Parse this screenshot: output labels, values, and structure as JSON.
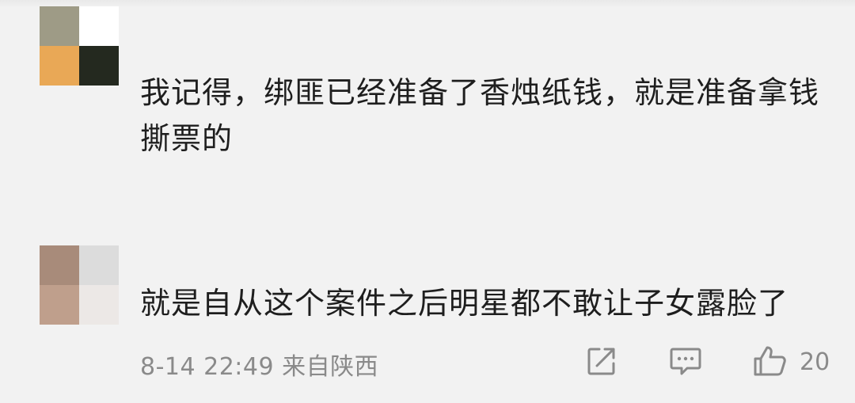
{
  "comments": [
    {
      "text": "我记得，绑匪已经准备了香烛纸钱，就是准备拿钱撕票的",
      "avatar_colors": [
        "#9e9b86",
        "#ffffff",
        "#e9a856",
        "#24291f"
      ]
    },
    {
      "text": "就是自从这个案件之后明星都不敢让子女露脸了",
      "avatar_colors": [
        "#a88b7a",
        "#dcdcdc",
        "#bf9f8c",
        "#ece8e6"
      ],
      "time": "8-14 22:49",
      "location": "来自陕西",
      "like_count": "20",
      "icons": {
        "share": "share-icon",
        "reply": "comment-icon",
        "like": "thumbs-up-icon"
      }
    }
  ],
  "colors": {
    "background": "#f2f2f2",
    "text": "#1e1e1e",
    "meta": "#8a8a8a"
  }
}
